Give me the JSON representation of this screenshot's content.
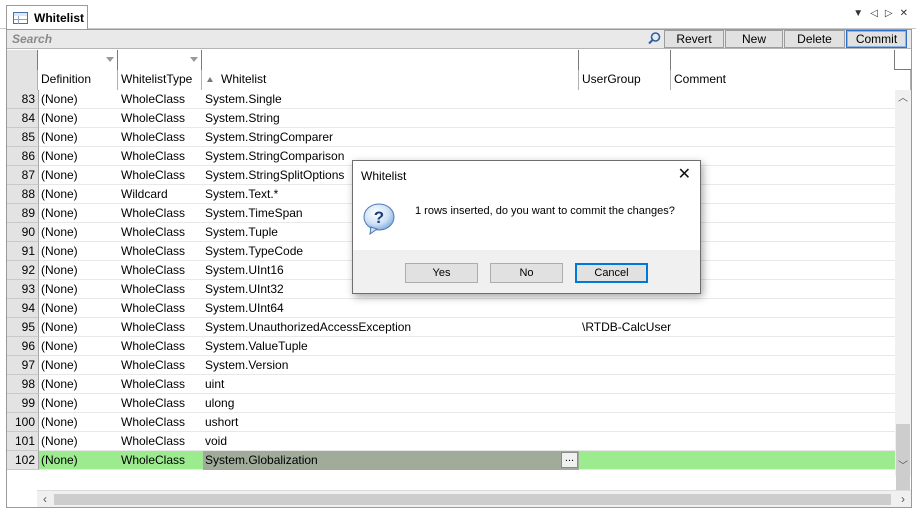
{
  "tab": {
    "title": "Whitelist"
  },
  "toolbar": {
    "search_placeholder": "Search",
    "revert_label": "Revert",
    "new_label": "New",
    "delete_label": "Delete",
    "commit_label": "Commit"
  },
  "columns": {
    "definition": "Definition",
    "whitelist_type": "WhitelistType",
    "whitelist": "Whitelist",
    "user_group": "UserGroup",
    "comment": "Comment"
  },
  "rows": [
    {
      "num": "83",
      "definition": "(None)",
      "type": "WholeClass",
      "whitelist": "System.Single",
      "user_group": "",
      "comment": ""
    },
    {
      "num": "84",
      "definition": "(None)",
      "type": "WholeClass",
      "whitelist": "System.String",
      "user_group": "",
      "comment": ""
    },
    {
      "num": "85",
      "definition": "(None)",
      "type": "WholeClass",
      "whitelist": "System.StringComparer",
      "user_group": "",
      "comment": ""
    },
    {
      "num": "86",
      "definition": "(None)",
      "type": "WholeClass",
      "whitelist": "System.StringComparison",
      "user_group": "",
      "comment": ""
    },
    {
      "num": "87",
      "definition": "(None)",
      "type": "WholeClass",
      "whitelist": "System.StringSplitOptions",
      "user_group": "",
      "comment": ""
    },
    {
      "num": "88",
      "definition": "(None)",
      "type": "Wildcard",
      "whitelist": "System.Text.*",
      "user_group": "",
      "comment": ""
    },
    {
      "num": "89",
      "definition": "(None)",
      "type": "WholeClass",
      "whitelist": "System.TimeSpan",
      "user_group": "",
      "comment": ""
    },
    {
      "num": "90",
      "definition": "(None)",
      "type": "WholeClass",
      "whitelist": "System.Tuple",
      "user_group": "",
      "comment": ""
    },
    {
      "num": "91",
      "definition": "(None)",
      "type": "WholeClass",
      "whitelist": "System.TypeCode",
      "user_group": "",
      "comment": ""
    },
    {
      "num": "92",
      "definition": "(None)",
      "type": "WholeClass",
      "whitelist": "System.UInt16",
      "user_group": "",
      "comment": ""
    },
    {
      "num": "93",
      "definition": "(None)",
      "type": "WholeClass",
      "whitelist": "System.UInt32",
      "user_group": "",
      "comment": ""
    },
    {
      "num": "94",
      "definition": "(None)",
      "type": "WholeClass",
      "whitelist": "System.UInt64",
      "user_group": "",
      "comment": ""
    },
    {
      "num": "95",
      "definition": "(None)",
      "type": "WholeClass",
      "whitelist": "System.UnauthorizedAccessException",
      "user_group": "\\RTDB-CalcUser",
      "comment": ""
    },
    {
      "num": "96",
      "definition": "(None)",
      "type": "WholeClass",
      "whitelist": "System.ValueTuple",
      "user_group": "",
      "comment": ""
    },
    {
      "num": "97",
      "definition": "(None)",
      "type": "WholeClass",
      "whitelist": "System.Version",
      "user_group": "",
      "comment": ""
    },
    {
      "num": "98",
      "definition": "(None)",
      "type": "WholeClass",
      "whitelist": "uint",
      "user_group": "",
      "comment": ""
    },
    {
      "num": "99",
      "definition": "(None)",
      "type": "WholeClass",
      "whitelist": "ulong",
      "user_group": "",
      "comment": ""
    },
    {
      "num": "100",
      "definition": "(None)",
      "type": "WholeClass",
      "whitelist": "ushort",
      "user_group": "",
      "comment": ""
    },
    {
      "num": "101",
      "definition": "(None)",
      "type": "WholeClass",
      "whitelist": "void",
      "user_group": "",
      "comment": ""
    },
    {
      "num": "102",
      "definition": "(None)",
      "type": "WholeClass",
      "whitelist": "System.Globalization",
      "user_group": "",
      "comment": "",
      "selected": true
    }
  ],
  "dialog": {
    "title": "Whitelist",
    "message": "1 rows inserted, do you want to commit the changes?",
    "yes_label": "Yes",
    "no_label": "No",
    "cancel_label": "Cancel"
  },
  "colors": {
    "selected_row": "#9ceb8f",
    "selected_cell": "#a0ab9a",
    "default_button_border": "#0078d7"
  }
}
